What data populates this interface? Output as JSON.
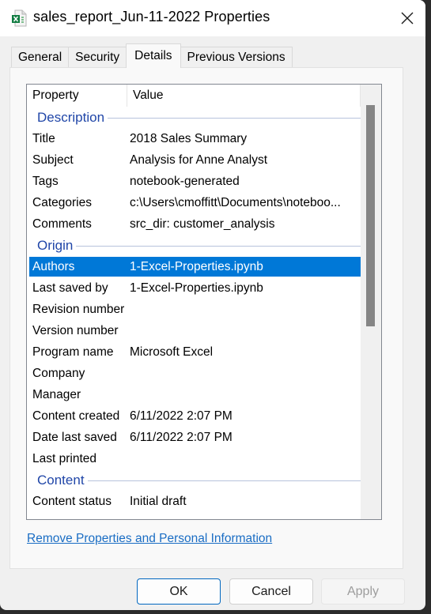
{
  "window": {
    "title": "sales_report_Jun-11-2022 Properties",
    "icon": "excel-file-icon",
    "close_icon": "close-icon"
  },
  "tabs": [
    {
      "label": "General",
      "selected": false
    },
    {
      "label": "Security",
      "selected": false
    },
    {
      "label": "Details",
      "selected": true
    },
    {
      "label": "Previous Versions",
      "selected": false
    }
  ],
  "details": {
    "columns": {
      "property": "Property",
      "value": "Value"
    },
    "groups": [
      {
        "label": "Description",
        "rows": [
          {
            "property": "Title",
            "value": "2018 Sales Summary"
          },
          {
            "property": "Subject",
            "value": "Analysis for Anne Analyst"
          },
          {
            "property": "Tags",
            "value": "notebook-generated"
          },
          {
            "property": "Categories",
            "value": "c:\\Users\\cmoffitt\\Documents\\noteboo..."
          },
          {
            "property": "Comments",
            "value": "src_dir: customer_analysis"
          }
        ]
      },
      {
        "label": "Origin",
        "rows": [
          {
            "property": "Authors",
            "value": "1-Excel-Properties.ipynb",
            "selected": true
          },
          {
            "property": "Last saved by",
            "value": "1-Excel-Properties.ipynb"
          },
          {
            "property": "Revision number",
            "value": ""
          },
          {
            "property": "Version number",
            "value": ""
          },
          {
            "property": "Program name",
            "value": "Microsoft Excel"
          },
          {
            "property": "Company",
            "value": ""
          },
          {
            "property": "Manager",
            "value": ""
          },
          {
            "property": "Content created",
            "value": "6/11/2022 2:07 PM"
          },
          {
            "property": "Date last saved",
            "value": "6/11/2022 2:07 PM"
          },
          {
            "property": "Last printed",
            "value": ""
          }
        ]
      },
      {
        "label": "Content",
        "rows": [
          {
            "property": "Content status",
            "value": "Initial draft"
          }
        ]
      }
    ]
  },
  "link": {
    "label": "Remove Properties and Personal Information"
  },
  "buttons": {
    "ok": "OK",
    "cancel": "Cancel",
    "apply": "Apply",
    "apply_enabled": false
  },
  "colors": {
    "selection": "#0078d7",
    "group_label": "#2046a8",
    "link": "#1a6dc4"
  }
}
